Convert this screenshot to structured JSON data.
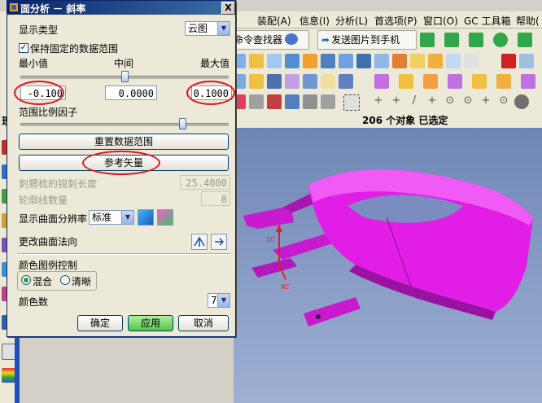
{
  "dialog": {
    "title": "面分析 － 斜率",
    "close_glyph": "X",
    "display_type_label": "显示类型",
    "display_type_value": "云图",
    "fixed_range_label": "保持固定的数据范围",
    "min_label": "最小值",
    "mid_label": "中间",
    "max_label": "最大值",
    "min_value": "-0.100",
    "mid_value": "0.0000",
    "max_value": "0.1000",
    "range_scale_label": "范围比例因子",
    "reset_range_button": "重置数据范围",
    "ref_vector_button": "参考矢量",
    "comb_length_label": "刺猬梳的锐刺长度",
    "comb_length_value": "25.4000",
    "contour_count_label": "轮廓线数量",
    "contour_count_value": "8",
    "resolution_label": "显示曲面分辨率",
    "resolution_value": "标准",
    "change_normal_label": "更改曲面法向",
    "color_legend_label": "颜色图例控制",
    "radio_blend": "混合",
    "radio_sharp": "清晰",
    "color_count_label": "颜色数",
    "color_count_value": "7",
    "ok_button": "确定",
    "apply_button": "应用",
    "cancel_button": "取消"
  },
  "menubar": {
    "items": [
      "I)",
      "装配(A)",
      "信息(I)",
      "分析(L)",
      "首选项(P)",
      "窗口(O)",
      "GC 工具箱",
      "帮助("
    ]
  },
  "toolbar": {
    "command_finder": "命令查找器",
    "send_to_phone": "发送图片到手机"
  },
  "status": {
    "text": "206 个对象 已选定",
    "left_label": "现"
  },
  "viewport": {
    "axis_z": "ZC",
    "axis_x": "XC"
  },
  "colors": {
    "model": "#e21ee6",
    "annotation": "#e0141e",
    "title_bar": "#0a246a"
  }
}
